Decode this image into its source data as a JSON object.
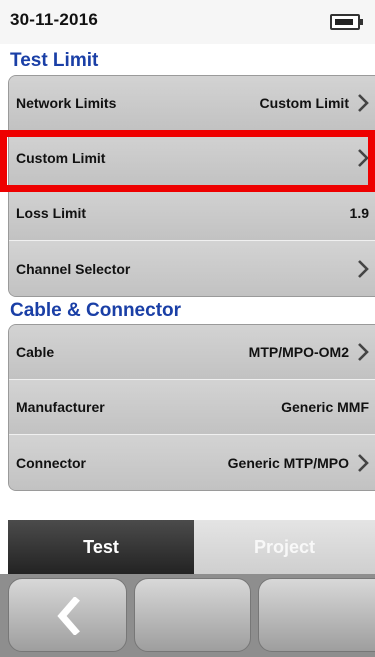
{
  "status": {
    "date": "30-11-2016",
    "battery_icon": "battery-icon"
  },
  "sections": {
    "test_limit_title": "Test Limit",
    "cable_connector_title": "Cable & Connector"
  },
  "test_limit_rows": [
    {
      "label": "Network Limits",
      "value": "Custom Limit",
      "has_chevron": true
    },
    {
      "label": "Custom Limit",
      "value": "",
      "has_chevron": true,
      "highlighted": true
    },
    {
      "label": "Loss Limit",
      "value": "1.9",
      "has_chevron": false
    },
    {
      "label": "Channel Selector",
      "value": "",
      "has_chevron": true
    }
  ],
  "cable_rows": [
    {
      "label": "Cable",
      "value": "MTP/MPO-OM2",
      "has_chevron": true
    },
    {
      "label": "Manufacturer",
      "value": "Generic MMF",
      "has_chevron": false
    },
    {
      "label": "Connector",
      "value": "Generic MTP/MPO",
      "has_chevron": true
    }
  ],
  "tabs": {
    "active": "Test",
    "inactive": "Project"
  },
  "bottom_buttons": {
    "back_icon": "chevron-left-icon"
  },
  "colors": {
    "section_title": "#1a3fa6",
    "highlight": "#ee0000"
  }
}
